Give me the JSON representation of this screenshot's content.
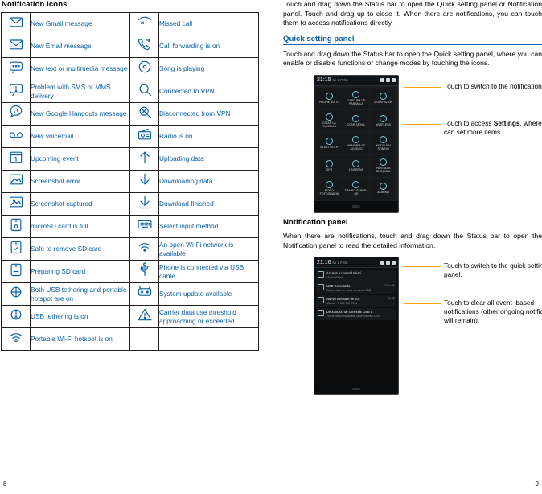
{
  "left_page": {
    "section_title": "Notification icons",
    "rows": [
      {
        "icon_left": "gmail-icon",
        "label_left": "New Gmail message",
        "icon_right": "missed-call-icon",
        "label_right": "Missed call"
      },
      {
        "icon_left": "email-icon",
        "label_left": "New Email message",
        "icon_right": "call-forwarding-icon",
        "label_right": "Call forwarding is on"
      },
      {
        "icon_left": "sms-mms-icon",
        "label_left": "New text or multimedia message",
        "icon_right": "music-playing-icon",
        "label_right": "Song is playing"
      },
      {
        "icon_left": "sms-problem-icon",
        "label_left": "Problem with SMS or MMS delivery",
        "icon_right": "vpn-connected-icon",
        "label_right": "Connected to VPN"
      },
      {
        "icon_left": "hangouts-icon",
        "label_left": "New Google Hangouts message",
        "icon_right": "vpn-disconnected-icon",
        "label_right": "Disconnected from VPN"
      },
      {
        "icon_left": "voicemail-icon",
        "label_left": "New voicemail",
        "icon_right": "radio-icon",
        "label_right": "Radio is on"
      },
      {
        "icon_left": "calendar-event-icon",
        "label_left": "Upcoming event",
        "icon_right": "upload-icon",
        "label_right": "Uploading data"
      },
      {
        "icon_left": "screenshot-error-icon",
        "label_left": "Screenshot error",
        "icon_right": "download-icon",
        "label_right": "Downloading data"
      },
      {
        "icon_left": "screenshot-captured-icon",
        "label_left": "Screenshot captured",
        "icon_right": "download-finished-icon",
        "label_right": "Download finished"
      },
      {
        "icon_left": "sdcard-full-icon",
        "label_left": "microSD card is full",
        "icon_right": "keyboard-icon",
        "label_right": "Select input method"
      },
      {
        "icon_left": "sdcard-safe-remove-icon",
        "label_left": "Safe to remove SD card",
        "icon_right": "wifi-open-network-icon",
        "label_right": "An open Wi-Fi network is available"
      },
      {
        "icon_left": "sdcard-preparing-icon",
        "label_left": "Preparing SD card",
        "icon_right": "usb-connected-icon",
        "label_right": "Phone is connected via USB cable"
      },
      {
        "icon_left": "usb-tethering-hotspot-icon",
        "label_left": "Both USB tethering and portable hotspot are on",
        "icon_right": "system-update-icon",
        "label_right": "System update available"
      },
      {
        "icon_left": "usb-tethering-icon",
        "label_left": "USB tethering is on",
        "icon_right": "carrier-data-warning-icon",
        "label_right": "Carrier data use threshold approaching or exceeded"
      },
      {
        "icon_left": "wifi-hotspot-icon",
        "label_left": "Portable Wi-Fi hotspot is on",
        "icon_right": "",
        "label_right": ""
      }
    ],
    "page_number": "8"
  },
  "right_page": {
    "intro_paragraph": "Touch and drag down the Status bar to open the Quick setting panel or Notification panel. Touch and drag up to close it. When there are notifications, you can touch them to access notifications directly.",
    "quick_setting": {
      "heading": "Quick setting panel",
      "paragraph": "Touch and drag down the Status bar to open the Quick setting panel, where you can enable or disable functions or change modes by touching the icons.",
      "callout_1": "Touch to switch to the notification panel.",
      "callout_2_pre": "Touch to access ",
      "callout_2_bold": "Settings",
      "callout_2_post": ", where you can set more items."
    },
    "notification_panel": {
      "heading": "Notification panel",
      "paragraph": "When there are notifications, touch and drag down the Status bar to open the Notification panel to read the detailed information.",
      "callout_1": "Touch to switch to the quick setting panel.",
      "callout_2": "Touch to clear all event–based notifications (other ongoing notifications will remain)."
    },
    "page_number": "9"
  },
  "phone_quick_settings": {
    "status_time": "21:15",
    "status_sub": "Mi 2 Febr.",
    "tiles": [
      {
        "label": "PROPIETAR\nIO",
        "on": false
      },
      {
        "label": "CAPTURA DE\nPANTALLA",
        "on": false
      },
      {
        "label": "MODO AVIÓN",
        "on": false
      },
      {
        "label": "GIRAR LA\nPANTALLA",
        "on": false
      },
      {
        "label": "CONN MÓVIL",
        "on": false
      },
      {
        "label": "WIRELESS",
        "on": false
      },
      {
        "label": "BLUETOOTH",
        "on": false
      },
      {
        "label": "MEMORIA\nDE ACCESO",
        "on": false
      },
      {
        "label": "MODO\nSIN SONIDO",
        "on": false
      },
      {
        "label": "GPS",
        "on": false
      },
      {
        "label": "LINTERNA",
        "on": false
      },
      {
        "label": "PANTALLA\nBLOQUEA",
        "on": false
      },
      {
        "label": "MODO\nFOTOGRAFÍA",
        "on": false
      },
      {
        "label": "TIEMPO\nESPERA DE",
        "on": false
      },
      {
        "label": "ALARMA",
        "on": false
      }
    ],
    "footer": "0/0C",
    "bottom_label": "TP-LINK"
  },
  "phone_notifications": {
    "status_time": "21:16",
    "status_sub": "Mi 2 Febr.",
    "items": [
      {
        "icon": "wifi-icon",
        "title": "Acceda a una red Wi-Fi",
        "subtitle": "\"AndroidTest\"",
        "right": ""
      },
      {
        "icon": "usb-icon",
        "title": "USB Conectado",
        "subtitle": "Toque para ver otras opciones USB",
        "right": "125 x 46"
      },
      {
        "icon": "sms-icon",
        "title": "Nuevo mensaje de voz",
        "subtitle": "Marcar +1 805 637 7243",
        "right": "21:08"
      },
      {
        "icon": "usb-icon",
        "title": "Depuración de conexión USB a",
        "subtitle": "Toque para deshabilitar la depuración USB",
        "right": ""
      }
    ],
    "footer": "0/0C"
  }
}
